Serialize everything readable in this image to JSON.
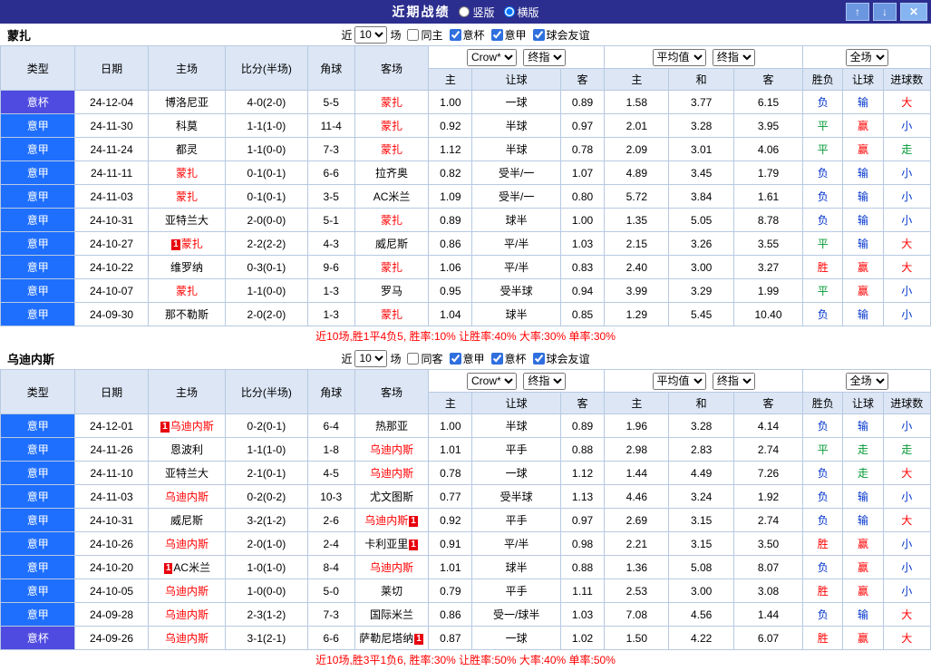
{
  "colors": {
    "titlebar_bg": "#2c2e8f",
    "header_bg": "#dce6f5",
    "grid_border": "#b7c9e2",
    "cup_bg": "#4f4be0",
    "league_bg": "#1f6fff",
    "team_highlight": "#ff0000",
    "win_red": "#ff0000",
    "draw_green": "#009933",
    "lose_blue": "#0033cc",
    "summary_red": "#ff0000",
    "button_blue": "#6b96e0",
    "close_blue": "#85b4f0"
  },
  "badge_label": "1",
  "titlebar": {
    "title": "近期战绩",
    "vertical_label": "竖版",
    "horizontal_label": "横版",
    "selected_layout": "横版",
    "up_icon": "↑",
    "down_icon": "↓",
    "close_icon": "✕"
  },
  "columns": [
    "类型",
    "日期",
    "主场",
    "比分(半场)",
    "角球",
    "客场",
    "主",
    "让球",
    "客",
    "主",
    "和",
    "客",
    "胜负",
    "让球",
    "进球数"
  ],
  "sections": [
    {
      "team": "蒙扎",
      "filter": {
        "near_label": "近",
        "count": "10",
        "games_label": "场",
        "checkboxes": [
          {
            "label": "同主",
            "checked": false
          },
          {
            "label": "意杯",
            "checked": true
          },
          {
            "label": "意甲",
            "checked": true
          },
          {
            "label": "球会友谊",
            "checked": true
          }
        ]
      },
      "dropdowns": {
        "company": "Crow*",
        "handicap_time": "终指",
        "average": "平均值",
        "euro_time": "终指",
        "scope": "全场"
      },
      "rows": [
        {
          "type": "意杯",
          "date": "24-12-04",
          "home": "博洛尼亚",
          "home_hot": false,
          "home_badge": null,
          "score": "4-0(2-0)",
          "corner": "5-5",
          "away": "蒙扎",
          "away_hot": true,
          "away_badge": null,
          "ah": [
            "1.00",
            "一球",
            "0.89"
          ],
          "eu": [
            "1.58",
            "3.77",
            "6.15"
          ],
          "res": [
            "负",
            "输",
            "大"
          ]
        },
        {
          "type": "意甲",
          "date": "24-11-30",
          "home": "科莫",
          "home_hot": false,
          "home_badge": null,
          "score": "1-1(1-0)",
          "corner": "11-4",
          "away": "蒙扎",
          "away_hot": true,
          "away_badge": null,
          "ah": [
            "0.92",
            "半球",
            "0.97"
          ],
          "eu": [
            "2.01",
            "3.28",
            "3.95"
          ],
          "res": [
            "平",
            "赢",
            "小"
          ]
        },
        {
          "type": "意甲",
          "date": "24-11-24",
          "home": "都灵",
          "home_hot": false,
          "home_badge": null,
          "score": "1-1(0-0)",
          "corner": "7-3",
          "away": "蒙扎",
          "away_hot": true,
          "away_badge": null,
          "ah": [
            "1.12",
            "半球",
            "0.78"
          ],
          "eu": [
            "2.09",
            "3.01",
            "4.06"
          ],
          "res": [
            "平",
            "赢",
            "走"
          ]
        },
        {
          "type": "意甲",
          "date": "24-11-11",
          "home": "蒙扎",
          "home_hot": true,
          "home_badge": null,
          "score": "0-1(0-1)",
          "corner": "6-6",
          "away": "拉齐奥",
          "away_hot": false,
          "away_badge": null,
          "ah": [
            "0.82",
            "受半/一",
            "1.07"
          ],
          "eu": [
            "4.89",
            "3.45",
            "1.79"
          ],
          "res": [
            "负",
            "输",
            "小"
          ]
        },
        {
          "type": "意甲",
          "date": "24-11-03",
          "home": "蒙扎",
          "home_hot": true,
          "home_badge": null,
          "score": "0-1(0-1)",
          "corner": "3-5",
          "away": "AC米兰",
          "away_hot": false,
          "away_badge": null,
          "ah": [
            "1.09",
            "受半/一",
            "0.80"
          ],
          "eu": [
            "5.72",
            "3.84",
            "1.61"
          ],
          "res": [
            "负",
            "输",
            "小"
          ]
        },
        {
          "type": "意甲",
          "date": "24-10-31",
          "home": "亚特兰大",
          "home_hot": false,
          "home_badge": null,
          "score": "2-0(0-0)",
          "corner": "5-1",
          "away": "蒙扎",
          "away_hot": true,
          "away_badge": null,
          "ah": [
            "0.89",
            "球半",
            "1.00"
          ],
          "eu": [
            "1.35",
            "5.05",
            "8.78"
          ],
          "res": [
            "负",
            "输",
            "小"
          ]
        },
        {
          "type": "意甲",
          "date": "24-10-27",
          "home": "蒙扎",
          "home_hot": true,
          "home_badge": "pre",
          "score": "2-2(2-2)",
          "corner": "4-3",
          "away": "威尼斯",
          "away_hot": false,
          "away_badge": null,
          "ah": [
            "0.86",
            "平/半",
            "1.03"
          ],
          "eu": [
            "2.15",
            "3.26",
            "3.55"
          ],
          "res": [
            "平",
            "输",
            "大"
          ]
        },
        {
          "type": "意甲",
          "date": "24-10-22",
          "home": "维罗纳",
          "home_hot": false,
          "home_badge": null,
          "score": "0-3(0-1)",
          "corner": "9-6",
          "away": "蒙扎",
          "away_hot": true,
          "away_badge": null,
          "ah": [
            "1.06",
            "平/半",
            "0.83"
          ],
          "eu": [
            "2.40",
            "3.00",
            "3.27"
          ],
          "res": [
            "胜",
            "赢",
            "大"
          ]
        },
        {
          "type": "意甲",
          "date": "24-10-07",
          "home": "蒙扎",
          "home_hot": true,
          "home_badge": null,
          "score": "1-1(0-0)",
          "corner": "1-3",
          "away": "罗马",
          "away_hot": false,
          "away_badge": null,
          "ah": [
            "0.95",
            "受半球",
            "0.94"
          ],
          "eu": [
            "3.99",
            "3.29",
            "1.99"
          ],
          "res": [
            "平",
            "赢",
            "小"
          ]
        },
        {
          "type": "意甲",
          "date": "24-09-30",
          "home": "那不勒斯",
          "home_hot": false,
          "home_badge": null,
          "score": "2-0(2-0)",
          "corner": "1-3",
          "away": "蒙扎",
          "away_hot": true,
          "away_badge": null,
          "ah": [
            "1.04",
            "球半",
            "0.85"
          ],
          "eu": [
            "1.29",
            "5.45",
            "10.40"
          ],
          "res": [
            "负",
            "输",
            "小"
          ]
        }
      ],
      "summary": "近10场,胜1平4负5, 胜率:10% 让胜率:40% 大率:30% 单率:30%"
    },
    {
      "team": "乌迪内斯",
      "filter": {
        "near_label": "近",
        "count": "10",
        "games_label": "场",
        "checkboxes": [
          {
            "label": "同客",
            "checked": false
          },
          {
            "label": "意甲",
            "checked": true
          },
          {
            "label": "意杯",
            "checked": true
          },
          {
            "label": "球会友谊",
            "checked": true
          }
        ]
      },
      "dropdowns": {
        "company": "Crow*",
        "handicap_time": "终指",
        "average": "平均值",
        "euro_time": "终指",
        "scope": "全场"
      },
      "rows": [
        {
          "type": "意甲",
          "date": "24-12-01",
          "home": "乌迪内斯",
          "home_hot": true,
          "home_badge": "pre",
          "score": "0-2(0-1)",
          "corner": "6-4",
          "away": "热那亚",
          "away_hot": false,
          "away_badge": null,
          "ah": [
            "1.00",
            "半球",
            "0.89"
          ],
          "eu": [
            "1.96",
            "3.28",
            "4.14"
          ],
          "res": [
            "负",
            "输",
            "小"
          ]
        },
        {
          "type": "意甲",
          "date": "24-11-26",
          "home": "恩波利",
          "home_hot": false,
          "home_badge": null,
          "score": "1-1(1-0)",
          "corner": "1-8",
          "away": "乌迪内斯",
          "away_hot": true,
          "away_badge": null,
          "ah": [
            "1.01",
            "平手",
            "0.88"
          ],
          "eu": [
            "2.98",
            "2.83",
            "2.74"
          ],
          "res": [
            "平",
            "走",
            "走"
          ]
        },
        {
          "type": "意甲",
          "date": "24-11-10",
          "home": "亚特兰大",
          "home_hot": false,
          "home_badge": null,
          "score": "2-1(0-1)",
          "corner": "4-5",
          "away": "乌迪内斯",
          "away_hot": true,
          "away_badge": null,
          "ah": [
            "0.78",
            "一球",
            "1.12"
          ],
          "eu": [
            "1.44",
            "4.49",
            "7.26"
          ],
          "res": [
            "负",
            "走",
            "大"
          ]
        },
        {
          "type": "意甲",
          "date": "24-11-03",
          "home": "乌迪内斯",
          "home_hot": true,
          "home_badge": null,
          "score": "0-2(0-2)",
          "corner": "10-3",
          "away": "尤文图斯",
          "away_hot": false,
          "away_badge": null,
          "ah": [
            "0.77",
            "受半球",
            "1.13"
          ],
          "eu": [
            "4.46",
            "3.24",
            "1.92"
          ],
          "res": [
            "负",
            "输",
            "小"
          ]
        },
        {
          "type": "意甲",
          "date": "24-10-31",
          "home": "威尼斯",
          "home_hot": false,
          "home_badge": null,
          "score": "3-2(1-2)",
          "corner": "2-6",
          "away": "乌迪内斯",
          "away_hot": true,
          "away_badge": "post",
          "ah": [
            "0.92",
            "平手",
            "0.97"
          ],
          "eu": [
            "2.69",
            "3.15",
            "2.74"
          ],
          "res": [
            "负",
            "输",
            "大"
          ]
        },
        {
          "type": "意甲",
          "date": "24-10-26",
          "home": "乌迪内斯",
          "home_hot": true,
          "home_badge": null,
          "score": "2-0(1-0)",
          "corner": "2-4",
          "away": "卡利亚里",
          "away_hot": false,
          "away_badge": "post",
          "ah": [
            "0.91",
            "平/半",
            "0.98"
          ],
          "eu": [
            "2.21",
            "3.15",
            "3.50"
          ],
          "res": [
            "胜",
            "赢",
            "小"
          ]
        },
        {
          "type": "意甲",
          "date": "24-10-20",
          "home": "AC米兰",
          "home_hot": false,
          "home_badge": "pre",
          "score": "1-0(1-0)",
          "corner": "8-4",
          "away": "乌迪内斯",
          "away_hot": true,
          "away_badge": null,
          "ah": [
            "1.01",
            "球半",
            "0.88"
          ],
          "eu": [
            "1.36",
            "5.08",
            "8.07"
          ],
          "res": [
            "负",
            "赢",
            "小"
          ]
        },
        {
          "type": "意甲",
          "date": "24-10-05",
          "home": "乌迪内斯",
          "home_hot": true,
          "home_badge": null,
          "score": "1-0(0-0)",
          "corner": "5-0",
          "away": "莱切",
          "away_hot": false,
          "away_badge": null,
          "ah": [
            "0.79",
            "平手",
            "1.11"
          ],
          "eu": [
            "2.53",
            "3.00",
            "3.08"
          ],
          "res": [
            "胜",
            "赢",
            "小"
          ]
        },
        {
          "type": "意甲",
          "date": "24-09-28",
          "home": "乌迪内斯",
          "home_hot": true,
          "home_badge": null,
          "score": "2-3(1-2)",
          "corner": "7-3",
          "away": "国际米兰",
          "away_hot": false,
          "away_badge": null,
          "ah": [
            "0.86",
            "受一/球半",
            "1.03"
          ],
          "eu": [
            "7.08",
            "4.56",
            "1.44"
          ],
          "res": [
            "负",
            "输",
            "大"
          ]
        },
        {
          "type": "意杯",
          "date": "24-09-26",
          "home": "乌迪内斯",
          "home_hot": true,
          "home_badge": null,
          "score": "3-1(2-1)",
          "corner": "6-6",
          "away": "萨勒尼塔纳",
          "away_hot": false,
          "away_badge": "post",
          "ah": [
            "0.87",
            "一球",
            "1.02"
          ],
          "eu": [
            "1.50",
            "4.22",
            "6.07"
          ],
          "res": [
            "胜",
            "赢",
            "大"
          ]
        }
      ],
      "summary": "近10场,胜3平1负6, 胜率:30% 让胜率:50% 大率:40% 单率:50%"
    }
  ]
}
